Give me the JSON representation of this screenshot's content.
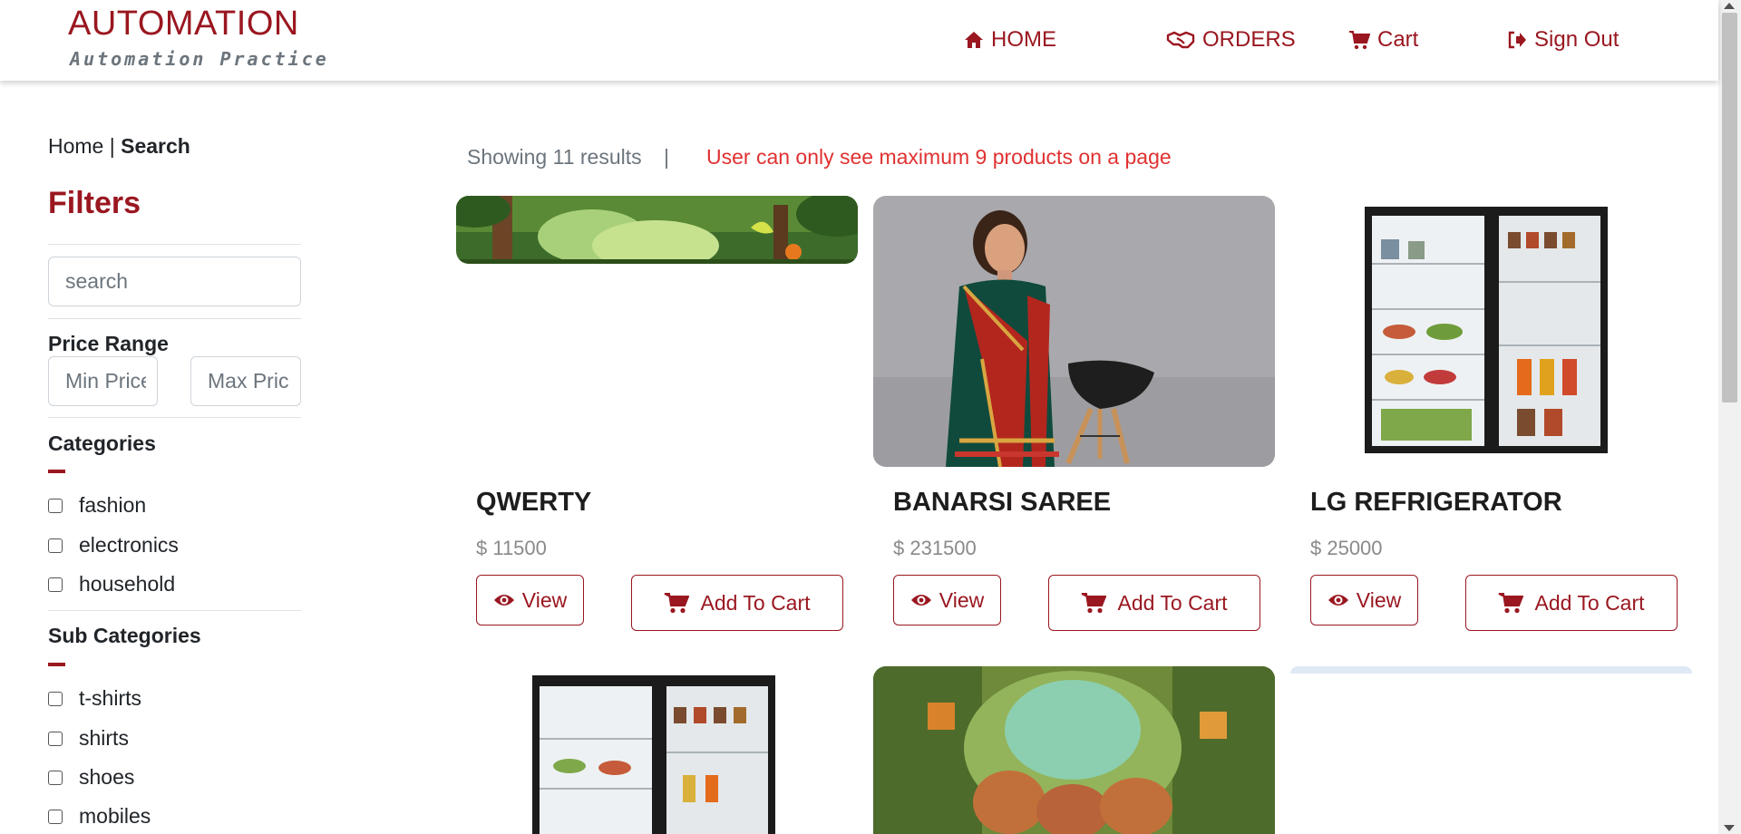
{
  "brand": {
    "title": "AUTOMATION",
    "subtitle": "Automation Practice"
  },
  "nav": [
    {
      "label": "HOME",
      "icon": "home-icon"
    },
    {
      "label": "ORDERS",
      "icon": "handshake-icon"
    },
    {
      "label": "Cart",
      "icon": "cart-icon"
    },
    {
      "label": "Sign Out",
      "icon": "sign-out-icon"
    }
  ],
  "breadcrumb": {
    "home": "Home",
    "separator": "|",
    "current": "Search"
  },
  "filters": {
    "title": "Filters",
    "search_placeholder": "search",
    "price_range_label": "Price Range",
    "min_price_placeholder": "Min Price",
    "max_price_placeholder": "Max Price",
    "categories_label": "Categories",
    "categories": [
      "fashion",
      "electronics",
      "household"
    ],
    "sub_categories_label": "Sub Categories",
    "sub_categories": [
      "t-shirts",
      "shirts",
      "shoes",
      "mobiles"
    ]
  },
  "results": {
    "count_text": "Showing 11 results",
    "separator": "|",
    "notice": "User can only see maximum 9 products on a page"
  },
  "buttons": {
    "view": "View",
    "add_to_cart": "Add To Cart"
  },
  "products": [
    {
      "name": "QWERTY",
      "price": "$ 11500"
    },
    {
      "name": "BANARSI SAREE",
      "price": "$ 231500"
    },
    {
      "name": "LG REFRIGERATOR",
      "price": "$ 25000"
    }
  ],
  "colors": {
    "brand": "#9a1720",
    "notice": "#e03131",
    "muted": "#6c757d"
  }
}
